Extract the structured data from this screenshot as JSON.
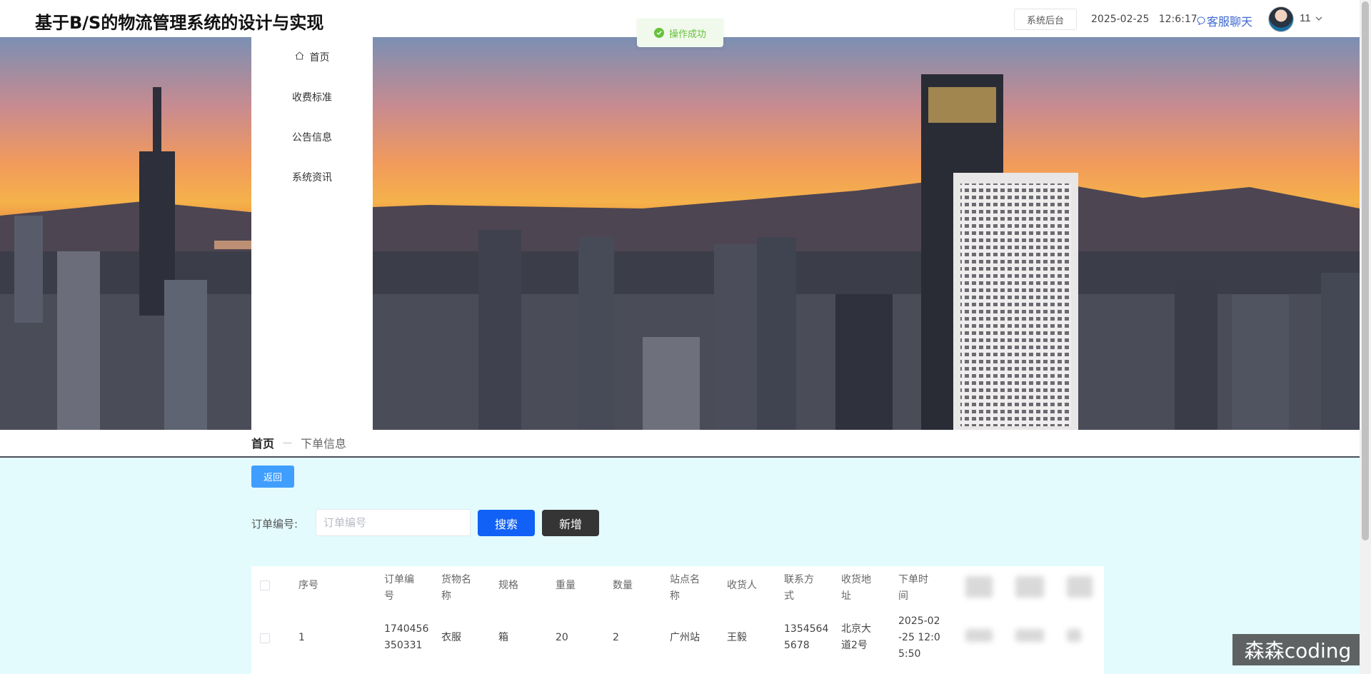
{
  "header": {
    "site_title": "基于B/S的物流管理系统的设计与实现",
    "admin_button": "系统后台",
    "date": "2025-02-25",
    "time": "12:6:17",
    "chat_link": "客服聊天",
    "user_name": "11"
  },
  "toast": {
    "message": "操作成功"
  },
  "sidenav": {
    "items": [
      {
        "label": "首页"
      },
      {
        "label": "收费标准"
      },
      {
        "label": "公告信息"
      },
      {
        "label": "系统资讯"
      }
    ]
  },
  "breadcrumb": {
    "home": "首页",
    "separator": "—",
    "current": "下单信息"
  },
  "toolbar": {
    "back_label": "返回",
    "search_label": "订单编号:",
    "search_placeholder": "订单编号",
    "search_button": "搜索",
    "add_button": "新增"
  },
  "table": {
    "headers": [
      "序号",
      "订单编号",
      "货物名称",
      "规格",
      "重量",
      "数量",
      "站点名称",
      "收货人",
      "联系方式",
      "收货地址",
      "下单时间"
    ],
    "header_lines": [
      [
        "序号"
      ],
      [
        "订单编",
        "号"
      ],
      [
        "货物名",
        "称"
      ],
      [
        "规格"
      ],
      [
        "重量"
      ],
      [
        "数量"
      ],
      [
        "站点名",
        "称"
      ],
      [
        "收货人"
      ],
      [
        "联系方",
        "式"
      ],
      [
        "收货地",
        "址"
      ],
      [
        "下单时",
        "间"
      ]
    ],
    "rows": [
      {
        "index": "1",
        "order_no": [
          "1740456",
          "350331"
        ],
        "goods": "衣服",
        "spec": "箱",
        "weight": "20",
        "quantity": "2",
        "station": "广州站",
        "receiver": "王毅",
        "phone": [
          "1354564",
          "5678"
        ],
        "address": [
          "北京大",
          "道2号"
        ],
        "order_time": [
          "2025-02",
          "-25 12:0",
          "5:50"
        ]
      }
    ]
  },
  "watermark": "森森coding",
  "colors": {
    "primary": "#1161f7",
    "back_button": "#409eff",
    "add_button": "#353535",
    "content_bg": "#e3fbfd",
    "success": "#67c23a",
    "chat_link": "#3e68d1"
  }
}
